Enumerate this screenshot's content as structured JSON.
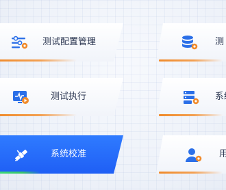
{
  "menu": {
    "items": [
      {
        "label": "测试配置管理",
        "icon": "sliders-gear-icon"
      },
      {
        "label": "测试执行",
        "icon": "monitor-play-icon"
      },
      {
        "label": "系统校准",
        "icon": "satellite-icon",
        "active": true
      },
      {
        "label": "测",
        "icon": "database-gear-icon"
      },
      {
        "label": "系统",
        "icon": "server-list-icon"
      },
      {
        "label": "用",
        "icon": "user-gear-icon"
      }
    ]
  },
  "colors": {
    "accent_blue": "#2f7bff",
    "accent_orange": "#f08a2a",
    "icon_blue": "#2b6fe8"
  }
}
